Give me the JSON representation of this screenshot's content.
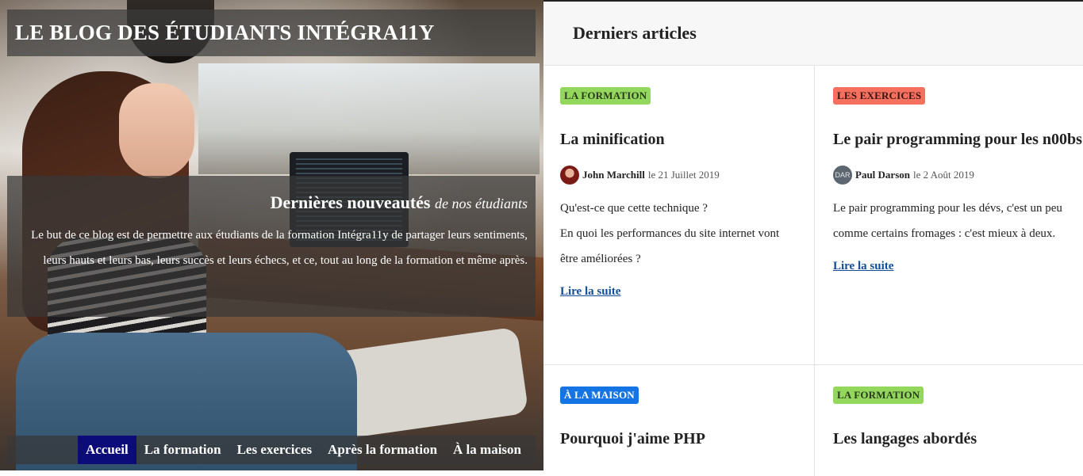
{
  "site": {
    "title": "LE BLOG DES ÉTUDIANTS INTÉGRA11Y",
    "intro_heading": "Dernières nouveautés",
    "intro_heading_em": "de nos étudiants",
    "intro_text": "Le but de ce blog est de permettre aux étudiants de la formation Intégra11y de partager leurs sentiments, leurs hauts et leurs bas, leurs succès et leurs échecs, et ce, tout au long de la formation et même après."
  },
  "nav": {
    "items": [
      {
        "label": "Accueil",
        "active": true
      },
      {
        "label": "La formation"
      },
      {
        "label": "Les exercices"
      },
      {
        "label": "Après la formation"
      },
      {
        "label": "À la maison"
      }
    ]
  },
  "panel": {
    "title": "Derniers articles"
  },
  "articles": [
    {
      "tag": "LA FORMATION",
      "tag_color": "#93d75c",
      "title": "La minification",
      "author": "John Marchill",
      "date": "le 21 Juillet 2019",
      "avatar_icon": "user-photo-icon",
      "excerpt_line1": "Qu'est-ce que cette technique ?",
      "excerpt_line2": "En quoi les performances du site internet vont être améliorées ?",
      "read_more": "Lire la suite"
    },
    {
      "tag": "LES EXERCICES",
      "tag_color": "#f5705f",
      "title": "Le pair programming pour les n00bs",
      "author": "Paul Darson",
      "date": "le 2 Août 2019",
      "avatar_text": "DAR",
      "excerpt_line1": "Le pair programming pour les dévs, c'est un peu comme certains fromages : c'est mieux à deux.",
      "read_more": "Lire la suite"
    },
    {
      "tag": "À LA MAISON",
      "tag_color": "#1574e3",
      "title": "Pourquoi j'aime PHP"
    },
    {
      "tag": "LA FORMATION",
      "tag_color": "#93d75c",
      "title": "Les langages abordés"
    }
  ]
}
